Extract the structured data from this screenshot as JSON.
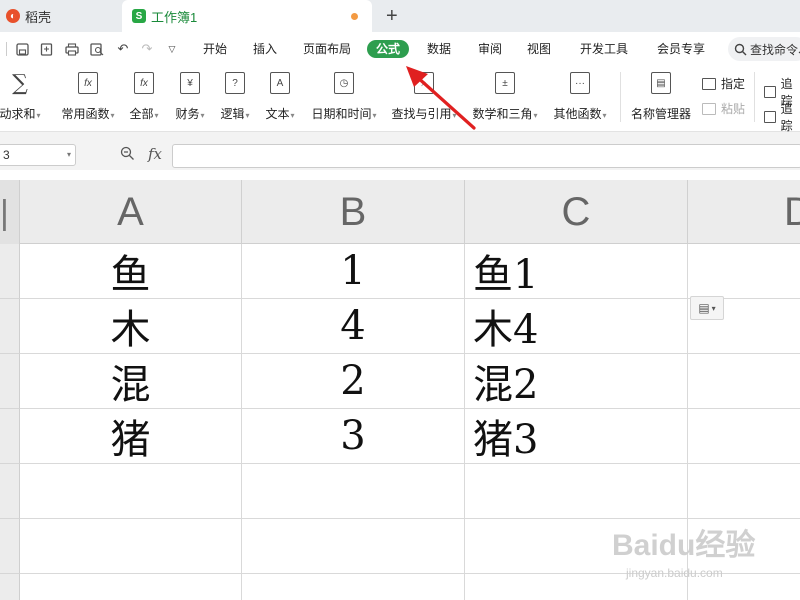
{
  "tabs": {
    "docer": "稻壳",
    "workbook": "工作簿1"
  },
  "quick_access": {
    "save_icon": "save-icon",
    "export_icon": "export-icon",
    "print_icon": "print-icon",
    "preview_icon": "print-preview-icon",
    "undo_icon": "undo-icon",
    "redo_icon": "redo-icon",
    "more_icon": "chevron-down-icon"
  },
  "menu": {
    "start": "开始",
    "insert": "插入",
    "page_layout": "页面布局",
    "formula": "公式",
    "data": "数据",
    "review": "审阅",
    "view": "视图",
    "developer": "开发工具",
    "member": "会员专享",
    "search_placeholder": "查找命令、"
  },
  "ribbon": {
    "autosum": "动求和",
    "common_func": "常用函数",
    "all": "全部",
    "finance": "财务",
    "logic": "逻辑",
    "text": "文本",
    "datetime": "日期和时间",
    "lookup": "查找与引用",
    "math": "数学和三角",
    "other": "其他函数",
    "name_manager": "名称管理器",
    "specify": "指定",
    "paste": "粘贴",
    "trace1": "追踪",
    "trace2": "追踪"
  },
  "formula_bar": {
    "name_box": "3",
    "fx": "fx"
  },
  "columns": [
    "A",
    "B",
    "C",
    "D"
  ],
  "rows": [
    {
      "a": "鱼",
      "b": "1",
      "c": "鱼1"
    },
    {
      "a": "木",
      "b": "4",
      "c": "木4"
    },
    {
      "a": "混",
      "b": "2",
      "c": "混2"
    },
    {
      "a": "猪",
      "b": "3",
      "c": "猪3"
    }
  ],
  "watermark": {
    "text": "Baidu经验",
    "sub": "jingyan.baidu.com"
  },
  "colors": {
    "accent": "#2e9e4f",
    "arrow": "#e02020"
  }
}
